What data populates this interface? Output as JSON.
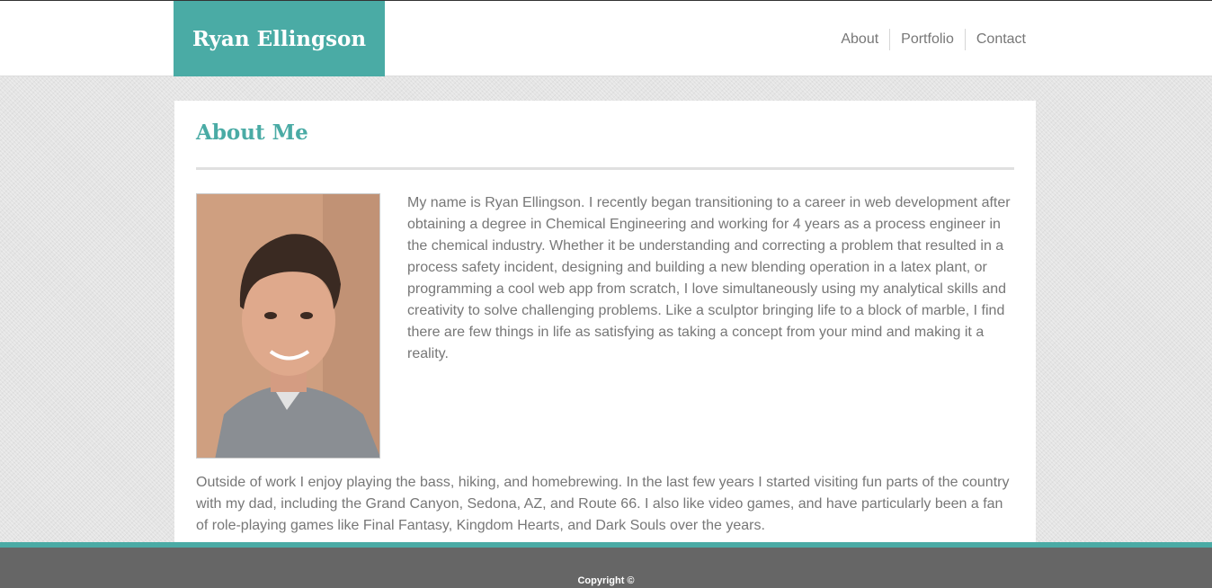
{
  "header": {
    "brand": "Ryan Ellingson",
    "nav": [
      "About",
      "Portfolio",
      "Contact"
    ]
  },
  "about": {
    "title": "About Me",
    "intro": "My name is Ryan Ellingson. I recently began transitioning to a career in web development after obtaining a degree in Chemical Engineering and working for 4 years as a process engineer in the chemical industry. Whether it be understanding and correcting a problem that resulted in a process safety incident, designing and building a new blending operation in a latex plant, or programming a cool web app from scratch, I love simultaneously using my analytical skills and creativity to solve challenging problems. Like a sculptor bringing life to a block of marble, I find there are few things in life as satisfying as taking a concept from your mind and making it a reality.",
    "outro": "Outside of work I enjoy playing the bass, hiking, and homebrewing. In the last few years I started visiting fun parts of the country with my dad, including the Grand Canyon, Sedona, AZ, and Route 66. I also like video games, and have particularly been a fan of role-playing games like Final Fantasy, Kingdom Hearts, and Dark Souls over the years."
  },
  "footer": {
    "copyright": "Copyright ©"
  },
  "colors": {
    "accent": "#4aaba5",
    "footer": "#666666",
    "text": "#777777"
  }
}
